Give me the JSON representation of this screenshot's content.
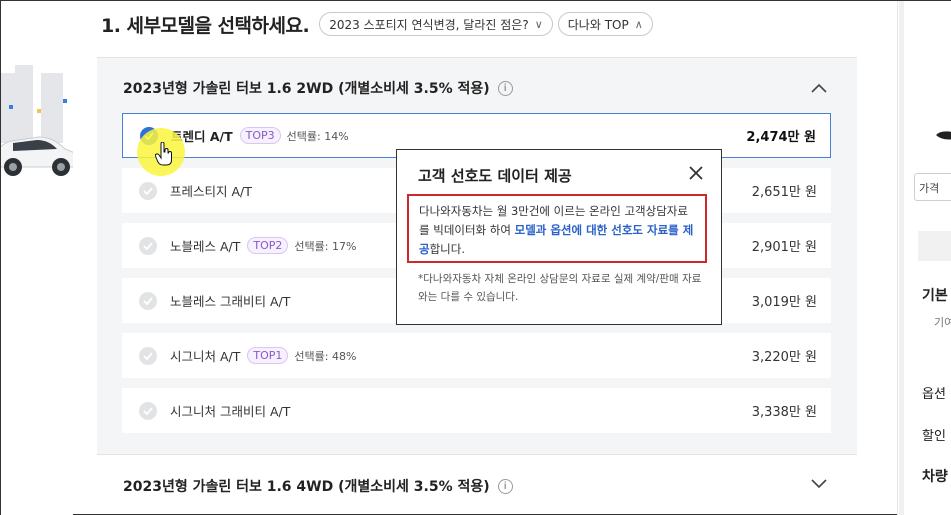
{
  "page": {
    "heading": "1. 세부모델을 선택하세요.",
    "pills": [
      {
        "label": "2023 스포티지 연식변경, 달라진 점은?",
        "chevron": "∨"
      },
      {
        "label": "다나와 TOP",
        "chevron": "∧"
      }
    ]
  },
  "section1": {
    "title": "2023년형 가솔린 터보 1.6 2WD (개별소비세 3.5% 적용)",
    "info": "i",
    "options": [
      {
        "name": "트렌디 A/T",
        "badge": "TOP3",
        "rate": "선택률: 14%",
        "price": "2,474만 원"
      },
      {
        "name": "프레스티지 A/T",
        "badge": "",
        "rate": "",
        "price": "2,651만 원"
      },
      {
        "name": "노블레스 A/T",
        "badge": "TOP2",
        "rate": "선택률: 17%",
        "price": "2,901만 원"
      },
      {
        "name": "노블레스 그래비티 A/T",
        "badge": "",
        "rate": "",
        "price": "3,019만 원"
      },
      {
        "name": "시그니처 A/T",
        "badge": "TOP1",
        "rate": "선택률: 48%",
        "price": "3,220만 원"
      },
      {
        "name": "시그니처 그래비티 A/T",
        "badge": "",
        "rate": "",
        "price": "3,338만 원"
      }
    ]
  },
  "section2": {
    "title": "2023년형 가솔린 터보 1.6 4WD (개별소비세 3.5% 적용)",
    "info": "i"
  },
  "popup": {
    "title": "고객 선호도 데이터 제공",
    "body_part1": "다나와자동차는 월 3만건에 이르는 온라인 고객상담자료를 빅데이터화 하여 ",
    "body_highlight": "모델과 옵션에 대한 선호도 자료를 제공",
    "body_part2": "합니다.",
    "note": "*다나와자동차 자체 온라인 상담문의 자료로 실제 계약/판매 자료와는 다를 수 있습니다."
  },
  "right_panel": {
    "input_text": "가격",
    "label_basic": "기본",
    "label_sub": "기여",
    "label_option": "옵션",
    "label_discount": "할인",
    "label_car": "차량"
  },
  "colors": {
    "accent_blue": "#2f6fd6",
    "highlight_red": "#cc2a2a",
    "badge_purple": "#8a58c9",
    "panel_bg": "#f4f5f7"
  }
}
